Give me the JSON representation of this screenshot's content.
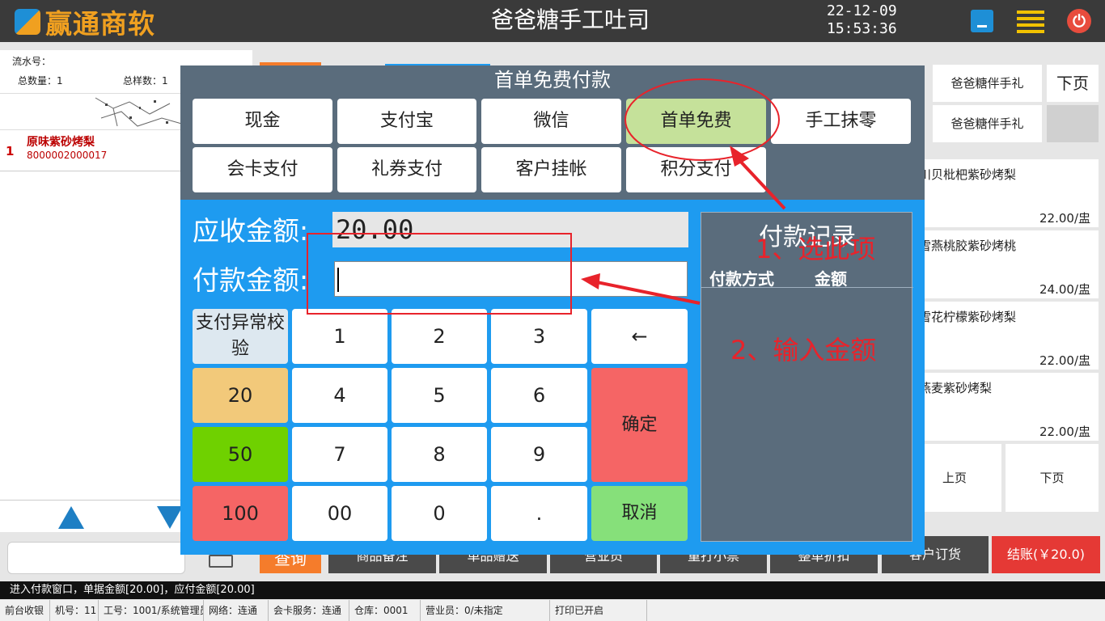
{
  "header": {
    "logo_text": "赢通商软",
    "store_name": "爸爸糖手工吐司",
    "date": "22-12-09",
    "time": "15:53:36",
    "power_glyph": "⏻"
  },
  "left_panel": {
    "serial_label": "流水号：",
    "total_qty_label": "总数量：1",
    "total_kinds_label": "总样数：1",
    "item_index": "1",
    "item_name": "原味紫砂烤梨",
    "item_code": "8000002000017"
  },
  "right_panel": {
    "product_tabs": [
      "爸爸糖伴手礼",
      "爸爸糖伴手礼"
    ],
    "next_page_top": "下页",
    "products": [
      {
        "name": "川贝枇杷紫砂烤梨",
        "price": "22.00/盅"
      },
      {
        "name": "雪燕桃胶紫砂烤桃",
        "price": "24.00/盅"
      },
      {
        "name": "雪花柠檬紫砂烤梨",
        "price": "22.00/盅"
      },
      {
        "name": "燕麦紫砂烤梨",
        "price": "22.00/盅"
      }
    ],
    "prev_page": "上页",
    "next_page": "下页"
  },
  "action_bar": {
    "query": "查询",
    "buttons": [
      "商品备注",
      "单品赠送",
      "营业员",
      "重打小票",
      "整单折扣",
      "客户订货"
    ],
    "settle": "结账(￥20.0)"
  },
  "status": {
    "message": "进入付款窗口，单据金额[20.00]，应付金额[20.00]",
    "items": [
      "前台收银",
      "机号：11",
      "工号：1001/系统管理员",
      "网络：连通",
      "会卡服务：连通",
      "仓库：0001",
      "营业员：0/未指定",
      "打印已开启"
    ]
  },
  "payment_dialog": {
    "title": "首单免费付款",
    "methods": [
      "现金",
      "支付宝",
      "微信",
      "首单免费",
      "手工抹零",
      "会卡支付",
      "礼券支付",
      "客户挂帐",
      "积分支付"
    ],
    "selected_method": "首单免费",
    "receivable_label": "应收金额:",
    "receivable_value": "20.00",
    "payment_label": "付款金额:",
    "payment_value": "",
    "keypad": {
      "check": "支付异常校验",
      "quick": [
        "20",
        "50",
        "100"
      ],
      "digits": [
        "1",
        "2",
        "3",
        "4",
        "5",
        "6",
        "7",
        "8",
        "9",
        "00",
        "0",
        "."
      ],
      "backspace": "←",
      "confirm": "确定",
      "cancel": "取消"
    },
    "records": {
      "title": "付款记录",
      "col_method": "付款方式",
      "col_amount": "金额"
    }
  },
  "annotations": {
    "step1": "1、选此项",
    "step2": "2、输入金额"
  },
  "colors": {
    "dialog_bg": "#5a6c7c",
    "keypad_bg": "#1e9bf0",
    "selected_method": "#c5e19a",
    "confirm": "#f56565",
    "cancel": "#86e07a",
    "quick_20": "#f2c97a",
    "quick_50": "#6fd100",
    "quick_100": "#f56565",
    "annotation": "#e8232b"
  }
}
